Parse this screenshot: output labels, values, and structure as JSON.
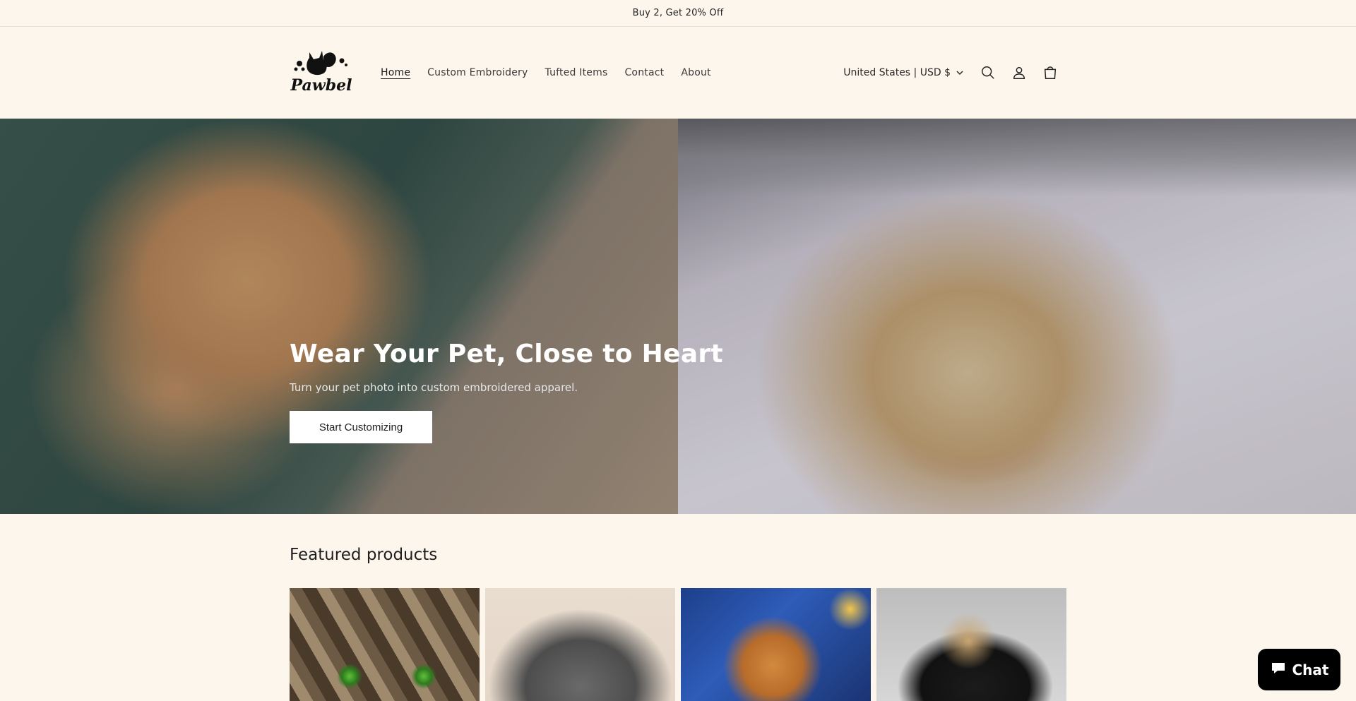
{
  "announcement": {
    "text": "Buy 2, Get 20% Off"
  },
  "brand": {
    "logo_alt": "Pawbel"
  },
  "nav": {
    "items": [
      {
        "label": "Home",
        "active": true
      },
      {
        "label": "Custom Embroidery",
        "active": false
      },
      {
        "label": "Tufted Items",
        "active": false
      },
      {
        "label": "Contact",
        "active": false
      },
      {
        "label": "About",
        "active": false
      }
    ]
  },
  "header": {
    "locale": "United States | USD $",
    "icons": [
      "search-icon",
      "account-icon",
      "cart-icon"
    ]
  },
  "hero": {
    "title": "Wear Your Pet, Close to Heart",
    "subtitle": "Turn your pet photo into custom embroidered apparel.",
    "cta": "Start Customizing"
  },
  "featured": {
    "title": "Featured products"
  },
  "chat": {
    "label": "Chat"
  },
  "colors": {
    "background": "#fdf6ec",
    "chat_button": "#000000",
    "hero_button": "#ffffff"
  }
}
